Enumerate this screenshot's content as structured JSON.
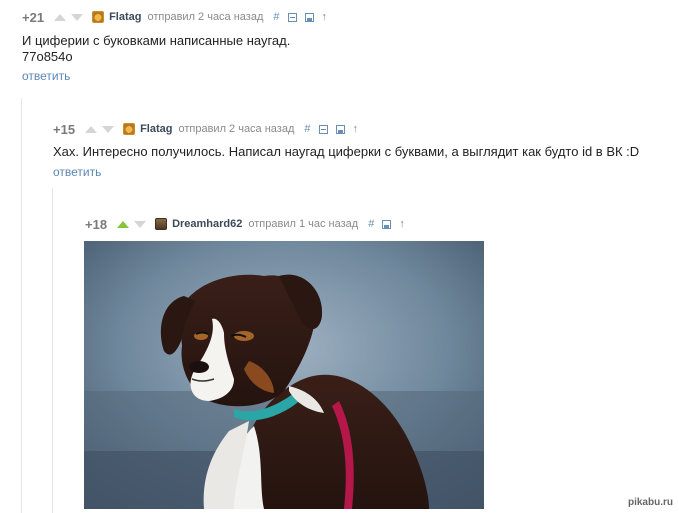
{
  "comments": [
    {
      "rating": "+21",
      "author": "Flatag",
      "time": "отправил 2 часа назад",
      "tools": [
        "#",
        "⊟",
        "🖫",
        "↑"
      ],
      "text_lines": [
        "И циферии с буковками написанные наугад.",
        "77o854o"
      ],
      "reply": "ответить",
      "upvoted": false
    },
    {
      "rating": "+15",
      "author": "Flatag",
      "time": "отправил 2 часа назад",
      "tools": [
        "#",
        "⊟",
        "🖫",
        "↑"
      ],
      "text": "Хах. Интересно получилось. Написал наугад циферки с буквами, а выглядит как будто id в ВК :D",
      "reply": "ответить",
      "upvoted": false
    },
    {
      "rating": "+18",
      "author": "Dreamhard62",
      "time": "отправил 1 час назад",
      "tools": [
        "#",
        "🖫",
        "↑"
      ],
      "upvoted": true,
      "image": {
        "subject": "dog",
        "collar_color": "#2aa6a6",
        "leash_color": "#b5174a"
      }
    }
  ],
  "watermark": "pikabu.ru",
  "colors": {
    "vote_active": "#86c43a",
    "link": "#5b86b5",
    "tool": "#6a8fb5"
  }
}
